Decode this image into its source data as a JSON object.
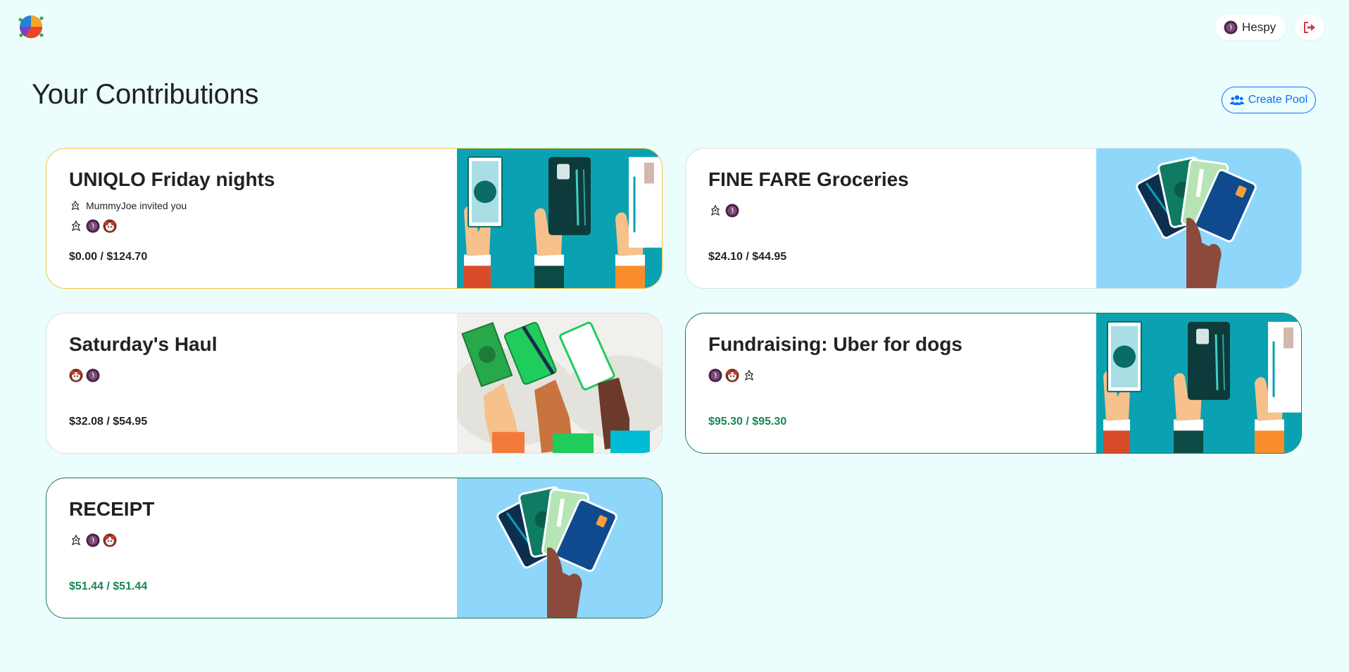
{
  "header": {
    "logo_icon": "pie-chart-logo-icon",
    "user_name": "Hespy",
    "logout_icon": "sign-out-icon"
  },
  "page": {
    "title": "Your Contributions",
    "create_pool_label": "Create Pool",
    "create_pool_icon": "users-icon"
  },
  "colors": {
    "background": "#ebfdfc",
    "primary": "#0d6efd",
    "success": "#198754",
    "pending_border": "#f4c542",
    "complete_border": "#1a7a52",
    "logout": "#dc3545"
  },
  "pools": [
    {
      "name": "UNIQLO Friday nights",
      "inviter_text": "MummyJoe invited you",
      "members": [
        "robot-avatar",
        "purple-avatar",
        "red-cat-avatar"
      ],
      "amount": "$0.00 / $124.70",
      "status": "pending",
      "illustration": "hands-cash-card-cheque"
    },
    {
      "name": "FINE FARE Groceries",
      "members": [
        "robot-avatar",
        "purple-avatar"
      ],
      "amount": "$24.10 / $44.95",
      "status": "partial",
      "illustration": "hand-fan-of-cards"
    },
    {
      "name": "Saturday's Haul",
      "members": [
        "red-cat-avatar",
        "purple-avatar"
      ],
      "amount": "$32.08 / $54.95",
      "status": "partial",
      "illustration": "hands-diverse-payments"
    },
    {
      "name": "Fundraising: Uber for dogs",
      "members": [
        "purple-avatar",
        "red-cat-avatar",
        "robot-avatar"
      ],
      "amount": "$95.30 / $95.30",
      "status": "complete",
      "illustration": "hands-cash-card-cheque"
    },
    {
      "name": "RECEIPT",
      "members": [
        "robot-avatar",
        "purple-avatar",
        "red-cat-avatar"
      ],
      "amount": "$51.44 / $51.44",
      "status": "complete",
      "illustration": "hand-fan-of-cards"
    }
  ]
}
